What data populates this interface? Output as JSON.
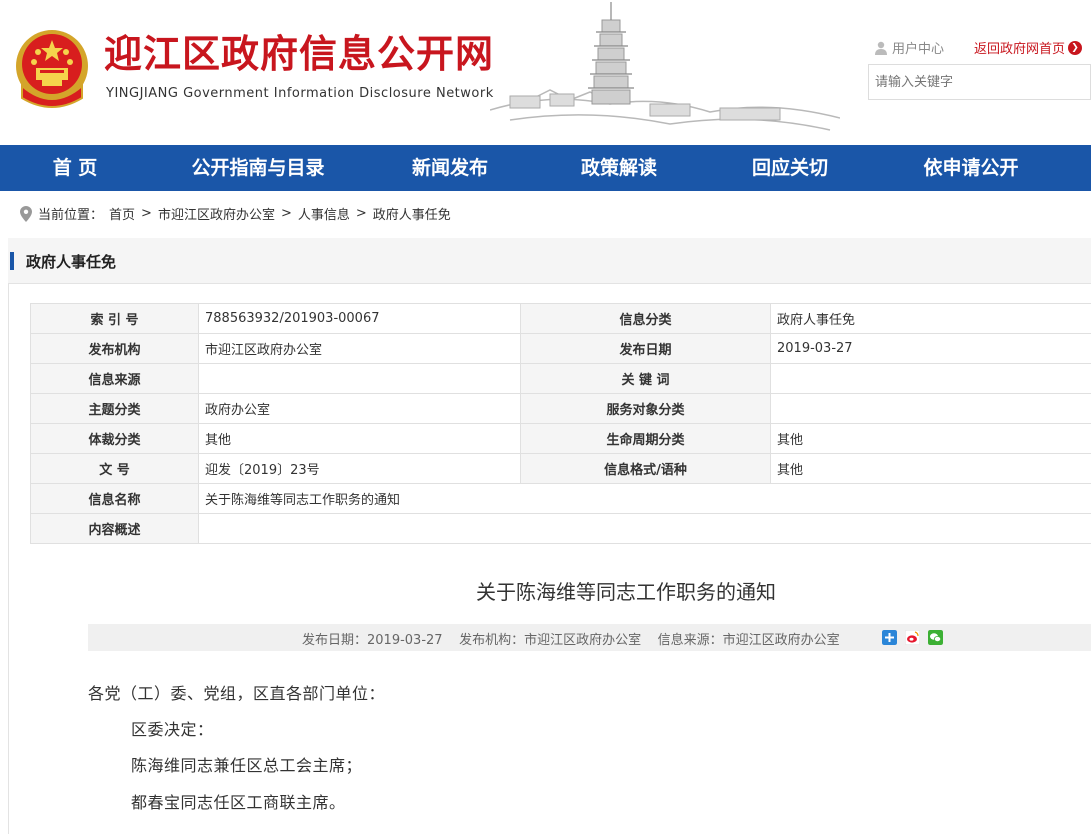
{
  "header": {
    "title": "迎江区政府信息公开网",
    "subtitle": "YINGJIANG Government Information Disclosure Network",
    "user_center": "用户中心",
    "back_link": "返回政府网首页",
    "search_placeholder": "请输入关键字",
    "colors": {
      "brand_red": "#c8161e",
      "nav_blue": "#1a56a8"
    }
  },
  "nav": {
    "items": [
      "首 页",
      "公开指南与目录",
      "新闻发布",
      "政策解读",
      "回应关切",
      "依申请公开"
    ]
  },
  "breadcrumb": {
    "prefix": "当前位置：",
    "items": [
      "首页",
      "市迎江区政府办公室",
      "人事信息",
      "政府人事任免"
    ],
    "separator": ">"
  },
  "panel": {
    "title": "政府人事任免"
  },
  "meta": {
    "rows": [
      {
        "l1": "索 引 号",
        "v1": "788563932/201903-00067",
        "l2": "信息分类",
        "v2": "政府人事任免"
      },
      {
        "l1": "发布机构",
        "v1": "市迎江区政府办公室",
        "l2": "发布日期",
        "v2": "2019-03-27"
      },
      {
        "l1": "信息来源",
        "v1": "",
        "l2": "关 键 词",
        "v2": ""
      },
      {
        "l1": "主题分类",
        "v1": "政府办公室",
        "l2": "服务对象分类",
        "v2": ""
      },
      {
        "l1": "体裁分类",
        "v1": "其他",
        "l2": "生命周期分类",
        "v2": "其他"
      },
      {
        "l1": "文 号",
        "v1": "迎发〔2019〕23号",
        "l2": "信息格式/语种",
        "v2": "其他"
      }
    ],
    "wide_rows": [
      {
        "l": "信息名称",
        "v": "关于陈海维等同志工作职务的通知"
      },
      {
        "l": "内容概述",
        "v": ""
      }
    ]
  },
  "article": {
    "title": "关于陈海维等同志工作职务的通知",
    "info": "发布日期：2019-03-27    发布机构：市迎江区政府办公室    信息来源：市迎江区政府办公室",
    "share_icons": [
      "plus-share-icon",
      "weibo-icon",
      "wechat-icon"
    ],
    "paragraphs": [
      "各党（工）委、党组，区直各部门单位：",
      "区委决定：",
      "陈海维同志兼任区总工会主席；",
      "都春宝同志任区工商联主席。"
    ]
  }
}
